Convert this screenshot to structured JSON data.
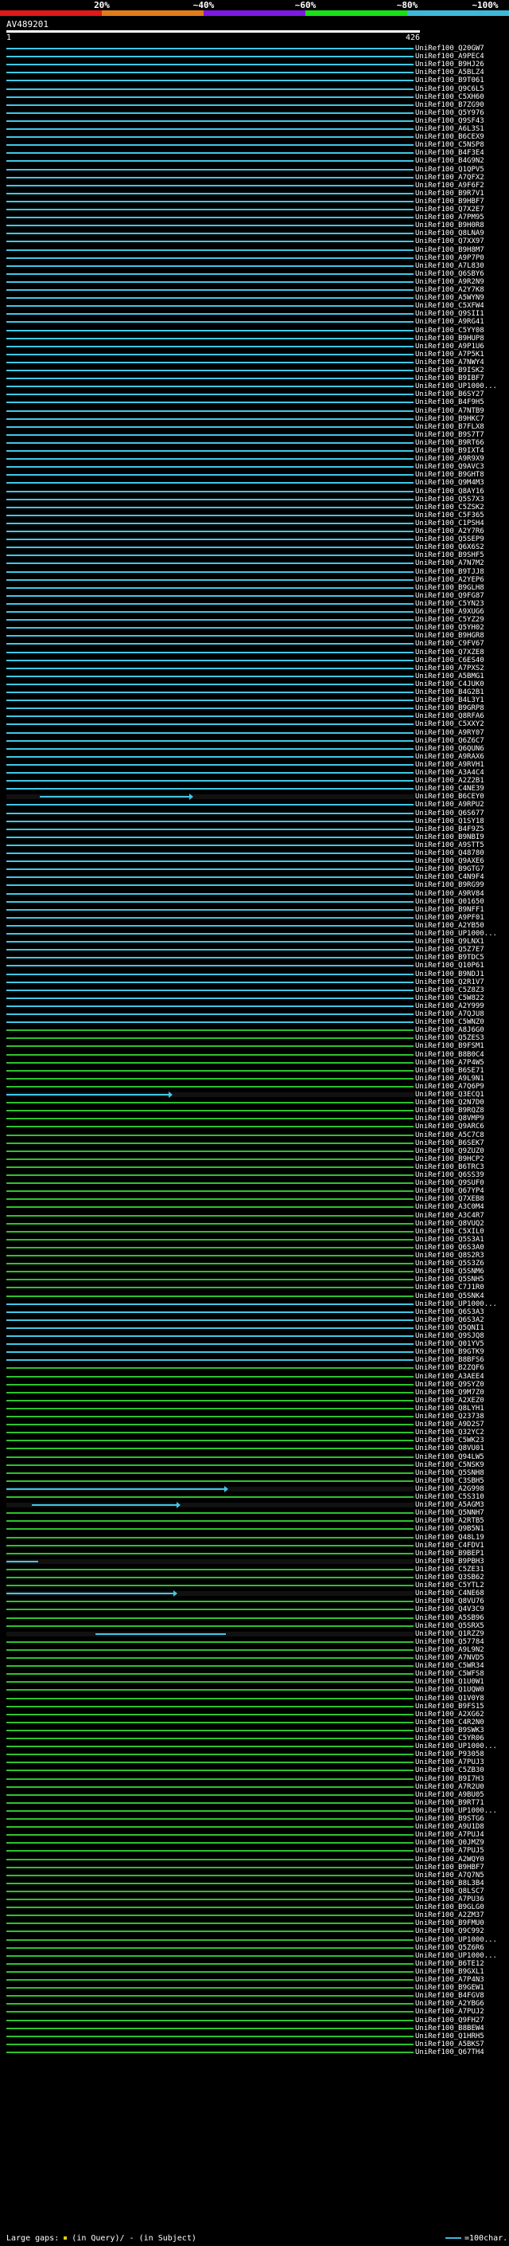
{
  "header": {
    "legend_labels": [
      "20%",
      "~40%",
      "~60%",
      "~80%",
      "~100%"
    ],
    "legend_colors": [
      "#e01919",
      "#e07d19",
      "#7d19e0",
      "#19e019",
      "#3fb8d8"
    ],
    "query_title": "AV489201",
    "ruler_start": "1",
    "ruler_end": "426"
  },
  "colors": {
    "cyan": "#3fb8d8",
    "green": "#19e019",
    "cyan_line": "#40c8e8",
    "green_line": "#2ec22e"
  },
  "hits": [
    {
      "label": "UniRef100_Q20GW7",
      "c": "cyan"
    },
    {
      "label": "UniRef100_A9PEC4",
      "c": "cyan"
    },
    {
      "label": "UniRef100_B9HJ26",
      "c": "cyan"
    },
    {
      "label": "UniRef100_A5BLZ4",
      "c": "cyan"
    },
    {
      "label": "UniRef100_B9T061",
      "c": "cyan"
    },
    {
      "label": "UniRef100_Q9C6L5",
      "c": "cyan"
    },
    {
      "label": "UniRef100_C5XH60",
      "c": "cyan"
    },
    {
      "label": "UniRef100_B7ZG90",
      "c": "cyan"
    },
    {
      "label": "UniRef100_Q5Y976",
      "c": "cyan"
    },
    {
      "label": "UniRef100_Q9SF43",
      "c": "cyan"
    },
    {
      "label": "UniRef100_A6L3S1",
      "c": "cyan"
    },
    {
      "label": "UniRef100_B6CEX9",
      "c": "cyan"
    },
    {
      "label": "UniRef100_C5NSP8",
      "c": "cyan"
    },
    {
      "label": "UniRef100_B4F3E4",
      "c": "cyan"
    },
    {
      "label": "UniRef100_B4G9N2",
      "c": "cyan"
    },
    {
      "label": "UniRef100_Q1QPV5",
      "c": "cyan"
    },
    {
      "label": "UniRef100_A7QFX2",
      "c": "cyan"
    },
    {
      "label": "UniRef100_A9F6F2",
      "c": "cyan"
    },
    {
      "label": "UniRef100_B9R7V1",
      "c": "cyan"
    },
    {
      "label": "UniRef100_B9HBF7",
      "c": "cyan"
    },
    {
      "label": "UniRef100_Q7X2E7",
      "c": "cyan"
    },
    {
      "label": "UniRef100_A7PM95",
      "c": "cyan"
    },
    {
      "label": "UniRef100_B9H0R8",
      "c": "cyan"
    },
    {
      "label": "UniRef100_Q8LNA9",
      "c": "cyan"
    },
    {
      "label": "UniRef100_Q7XX97",
      "c": "cyan"
    },
    {
      "label": "UniRef100_B9H8M7",
      "c": "cyan"
    },
    {
      "label": "UniRef100_A9P7P0",
      "c": "cyan"
    },
    {
      "label": "UniRef100_A7L830",
      "c": "cyan"
    },
    {
      "label": "UniRef100_Q6SBY6",
      "c": "cyan"
    },
    {
      "label": "UniRef100_A9R2N9",
      "c": "cyan"
    },
    {
      "label": "UniRef100_A2Y7K8",
      "c": "cyan"
    },
    {
      "label": "UniRef100_A5WYN9",
      "c": "cyan"
    },
    {
      "label": "UniRef100_C5XFW4",
      "c": "cyan"
    },
    {
      "label": "UniRef100_Q9SII1",
      "c": "cyan"
    },
    {
      "label": "UniRef100_A9RG41",
      "c": "cyan"
    },
    {
      "label": "UniRef100_C5YY08",
      "c": "cyan"
    },
    {
      "label": "UniRef100_B9HUP8",
      "c": "cyan"
    },
    {
      "label": "UniRef100_A9P1U6",
      "c": "cyan"
    },
    {
      "label": "UniRef100_A7P5K1",
      "c": "cyan"
    },
    {
      "label": "UniRef100_A7NWY4",
      "c": "cyan"
    },
    {
      "label": "UniRef100_B9ISK2",
      "c": "cyan"
    },
    {
      "label": "UniRef100_B9IBF7",
      "c": "cyan"
    },
    {
      "label": "UniRef100_UP1000...",
      "c": "cyan"
    },
    {
      "label": "UniRef100_B6SY27",
      "c": "cyan"
    },
    {
      "label": "UniRef100_B4F9H5",
      "c": "cyan"
    },
    {
      "label": "UniRef100_A7NTB9",
      "c": "cyan"
    },
    {
      "label": "UniRef100_B9HKC7",
      "c": "cyan"
    },
    {
      "label": "UniRef100_B7FLX8",
      "c": "cyan"
    },
    {
      "label": "UniRef100_B9S7T7",
      "c": "cyan"
    },
    {
      "label": "UniRef100_B9RT66",
      "c": "cyan"
    },
    {
      "label": "UniRef100_B9IXT4",
      "c": "cyan"
    },
    {
      "label": "UniRef100_A9R9X9",
      "c": "cyan"
    },
    {
      "label": "UniRef100_Q9AVC3",
      "c": "cyan"
    },
    {
      "label": "UniRef100_B9GHT8",
      "c": "cyan"
    },
    {
      "label": "UniRef100_Q9M4M3",
      "c": "cyan"
    },
    {
      "label": "UniRef100_Q8AY16",
      "c": "cyan"
    },
    {
      "label": "UniRef100_Q5S7X3",
      "c": "cyan"
    },
    {
      "label": "UniRef100_C5ZSK2",
      "c": "cyan"
    },
    {
      "label": "UniRef100_C5F365",
      "c": "cyan"
    },
    {
      "label": "UniRef100_C1PSH4",
      "c": "cyan"
    },
    {
      "label": "UniRef100_A2Y7R6",
      "c": "cyan"
    },
    {
      "label": "UniRef100_Q5SEP9",
      "c": "cyan"
    },
    {
      "label": "UniRef100_Q6X6S2",
      "c": "cyan"
    },
    {
      "label": "UniRef100_B9SHF5",
      "c": "cyan"
    },
    {
      "label": "UniRef100_A7N7M2",
      "c": "cyan"
    },
    {
      "label": "UniRef100_B9TJJ8",
      "c": "cyan"
    },
    {
      "label": "UniRef100_A2YEP6",
      "c": "cyan"
    },
    {
      "label": "UniRef100_B9GLH8",
      "c": "cyan"
    },
    {
      "label": "UniRef100_Q9FG87",
      "c": "cyan"
    },
    {
      "label": "UniRef100_C5YN23",
      "c": "cyan"
    },
    {
      "label": "UniRef100_A9XUG6",
      "c": "cyan"
    },
    {
      "label": "UniRef100_C5YZ29",
      "c": "cyan"
    },
    {
      "label": "UniRef100_Q5YH02",
      "c": "cyan"
    },
    {
      "label": "UniRef100_B9HGR8",
      "c": "cyan"
    },
    {
      "label": "UniRef100_C9FV67",
      "c": "cyan"
    },
    {
      "label": "UniRef100_Q7XZE8",
      "c": "cyan"
    },
    {
      "label": "UniRef100_C6ES40",
      "c": "cyan"
    },
    {
      "label": "UniRef100_A7PXS2",
      "c": "cyan"
    },
    {
      "label": "UniRef100_A5BMG1",
      "c": "cyan"
    },
    {
      "label": "UniRef100_C4JUK0",
      "c": "cyan"
    },
    {
      "label": "UniRef100_B4G2B1",
      "c": "cyan"
    },
    {
      "label": "UniRef100_B4L3Y1",
      "c": "cyan"
    },
    {
      "label": "UniRef100_B9GRP8",
      "c": "cyan"
    },
    {
      "label": "UniRef100_Q8RFA6",
      "c": "cyan"
    },
    {
      "label": "UniRef100_C5XXY2",
      "c": "cyan"
    },
    {
      "label": "UniRef100_A9RY07",
      "c": "cyan"
    },
    {
      "label": "UniRef100_Q6Z6C7",
      "c": "cyan"
    },
    {
      "label": "UniRef100_Q6QUN6",
      "c": "cyan"
    },
    {
      "label": "UniRef100_A9RAX6",
      "c": "cyan"
    },
    {
      "label": "UniRef100_A9RVH1",
      "c": "cyan"
    },
    {
      "label": "UniRef100_A3A4C4",
      "c": "cyan"
    },
    {
      "label": "UniRef100_A2Z2B1",
      "c": "cyan"
    },
    {
      "label": "UniRef100_C4NE39",
      "c": "cyan"
    },
    {
      "label": "UniRef100_B6CEY0",
      "c": "cyan",
      "partial": [
        50,
        238
      ],
      "arrow": true
    },
    {
      "label": "UniRef100_A9RPU2",
      "c": "cyan"
    },
    {
      "label": "UniRef100_Q6S677",
      "c": "cyan"
    },
    {
      "label": "UniRef100_Q1SY18",
      "c": "cyan"
    },
    {
      "label": "UniRef100_B4F9Z5",
      "c": "cyan"
    },
    {
      "label": "UniRef100_B9NBI9",
      "c": "cyan"
    },
    {
      "label": "UniRef100_A9STT5",
      "c": "cyan"
    },
    {
      "label": "UniRef100_Q48780",
      "c": "cyan"
    },
    {
      "label": "UniRef100_Q9AXE6",
      "c": "cyan"
    },
    {
      "label": "UniRef100_B9GTG7",
      "c": "cyan"
    },
    {
      "label": "UniRef100_C4N9F4",
      "c": "cyan"
    },
    {
      "label": "UniRef100_B9RG99",
      "c": "cyan"
    },
    {
      "label": "UniRef100_A9RV84",
      "c": "cyan"
    },
    {
      "label": "UniRef100_Q01650",
      "c": "cyan"
    },
    {
      "label": "UniRef100_B9NFF1",
      "c": "cyan"
    },
    {
      "label": "UniRef100_A9PF01",
      "c": "cyan"
    },
    {
      "label": "UniRef100_A2YB50",
      "c": "cyan"
    },
    {
      "label": "UniRef100_UP1000...",
      "c": "cyan"
    },
    {
      "label": "UniRef100_Q9LNX1",
      "c": "cyan"
    },
    {
      "label": "UniRef100_Q5Z7E7",
      "c": "cyan"
    },
    {
      "label": "UniRef100_B9TDC5",
      "c": "cyan"
    },
    {
      "label": "UniRef100_Q10P61",
      "c": "cyan"
    },
    {
      "label": "UniRef100_B9NDJ1",
      "c": "cyan"
    },
    {
      "label": "UniRef100_Q2R1V7",
      "c": "cyan"
    },
    {
      "label": "UniRef100_C5Z8Z3",
      "c": "cyan"
    },
    {
      "label": "UniRef100_C5W822",
      "c": "cyan"
    },
    {
      "label": "UniRef100_A2Y999",
      "c": "cyan"
    },
    {
      "label": "UniRef100_A7QJU8",
      "c": "cyan"
    },
    {
      "label": "UniRef100_C5WNZ0",
      "c": "cyan"
    },
    {
      "label": "UniRef100_A8J6G0",
      "c": "green"
    },
    {
      "label": "UniRef100_Q5ZES3",
      "c": "green"
    },
    {
      "label": "UniRef100_B9FSM1",
      "c": "green"
    },
    {
      "label": "UniRef100_B8B0C4",
      "c": "green"
    },
    {
      "label": "UniRef100_A7P4W5",
      "c": "green"
    },
    {
      "label": "UniRef100_B6SE71",
      "c": "green"
    },
    {
      "label": "UniRef100_A9L9N1",
      "c": "green"
    },
    {
      "label": "UniRef100_A7Q6P9",
      "c": "green"
    },
    {
      "label": "UniRef100_Q3ECQ1",
      "c": "cyan",
      "partial": [
        8,
        212
      ],
      "arrow": true
    },
    {
      "label": "UniRef100_Q2N7D0",
      "c": "green"
    },
    {
      "label": "UniRef100_B9RQZ8",
      "c": "green"
    },
    {
      "label": "UniRef100_Q8VMP9",
      "c": "green"
    },
    {
      "label": "UniRef100_Q9ARC6",
      "c": "green"
    },
    {
      "label": "UniRef100_A5C7C8",
      "c": "green"
    },
    {
      "label": "UniRef100_B6SEK7",
      "c": "green"
    },
    {
      "label": "UniRef100_Q9ZUZ0",
      "c": "green"
    },
    {
      "label": "UniRef100_B9HCP2",
      "c": "green"
    },
    {
      "label": "UniRef100_B6TRC3",
      "c": "green"
    },
    {
      "label": "UniRef100_Q6SS39",
      "c": "green"
    },
    {
      "label": "UniRef100_Q9SUF0",
      "c": "green"
    },
    {
      "label": "UniRef100_Q67YP4",
      "c": "green"
    },
    {
      "label": "UniRef100_Q7XEB8",
      "c": "green"
    },
    {
      "label": "UniRef100_A3C0M4",
      "c": "green"
    },
    {
      "label": "UniRef100_A3C4R7",
      "c": "green"
    },
    {
      "label": "UniRef100_Q8VUQ2",
      "c": "green"
    },
    {
      "label": "UniRef100_C5XIL0",
      "c": "green"
    },
    {
      "label": "UniRef100_Q5S3A1",
      "c": "green"
    },
    {
      "label": "UniRef100_Q6S3A0",
      "c": "green"
    },
    {
      "label": "UniRef100_Q8S2R3",
      "c": "green"
    },
    {
      "label": "UniRef100_Q5S3Z6",
      "c": "green"
    },
    {
      "label": "UniRef100_Q5SNM6",
      "c": "green"
    },
    {
      "label": "UniRef100_Q5SNH5",
      "c": "green"
    },
    {
      "label": "UniRef100_C7J1R0",
      "c": "green"
    },
    {
      "label": "UniRef100_Q5SNK4",
      "c": "green"
    },
    {
      "label": "UniRef100_UP1000...",
      "c": "cyan"
    },
    {
      "label": "UniRef100_Q6S3A3",
      "c": "cyan"
    },
    {
      "label": "UniRef100_Q6S3A2",
      "c": "cyan"
    },
    {
      "label": "UniRef100_Q5QNI1",
      "c": "cyan"
    },
    {
      "label": "UniRef100_Q9SJQ8",
      "c": "cyan"
    },
    {
      "label": "UniRef100_Q01YV5",
      "c": "cyan"
    },
    {
      "label": "UniRef100_B9GTK9",
      "c": "cyan"
    },
    {
      "label": "UniRef100_B8BFS6",
      "c": "cyan"
    },
    {
      "label": "UniRef100_B2ZQF6",
      "c": "green"
    },
    {
      "label": "UniRef100_A3AEE4",
      "c": "green"
    },
    {
      "label": "UniRef100_Q9SYZ0",
      "c": "green"
    },
    {
      "label": "UniRef100_Q9M7Z0",
      "c": "green"
    },
    {
      "label": "UniRef100_A2XEZ0",
      "c": "green"
    },
    {
      "label": "UniRef100_Q8LYH1",
      "c": "green"
    },
    {
      "label": "UniRef100_Q23738",
      "c": "green"
    },
    {
      "label": "UniRef100_A9D2S7",
      "c": "green"
    },
    {
      "label": "UniRef100_Q32YC2",
      "c": "green"
    },
    {
      "label": "UniRef100_C5WK23",
      "c": "green"
    },
    {
      "label": "UniRef100_Q8VU01",
      "c": "green"
    },
    {
      "label": "UniRef100_Q94LW5",
      "c": "green"
    },
    {
      "label": "UniRef100_C5NSK9",
      "c": "green"
    },
    {
      "label": "UniRef100_Q5SNH8",
      "c": "green"
    },
    {
      "label": "UniRef100_C3SBH5",
      "c": "green"
    },
    {
      "label": "UniRef100_A2G998",
      "c": "cyan",
      "partial": [
        8,
        282
      ],
      "arrow": true
    },
    {
      "label": "UniRef100_C5S310",
      "c": "green"
    },
    {
      "label": "UniRef100_A5AGM3",
      "c": "cyan",
      "partial": [
        40,
        222
      ],
      "arrow": true
    },
    {
      "label": "UniRef100_Q5NNH7",
      "c": "green"
    },
    {
      "label": "UniRef100_A2RTB5",
      "c": "green"
    },
    {
      "label": "UniRef100_Q9B5N1",
      "c": "green"
    },
    {
      "label": "UniRef100_Q48L19",
      "c": "green"
    },
    {
      "label": "UniRef100_C4FDV1",
      "c": "green"
    },
    {
      "label": "UniRef100_B9BEP1",
      "c": "green"
    },
    {
      "label": "UniRef100_B9PBH3",
      "c": "cyan",
      "partial": [
        8,
        48
      ],
      "arrow": false
    },
    {
      "label": "UniRef100_C5ZE31",
      "c": "green"
    },
    {
      "label": "UniRef100_Q3SB62",
      "c": "green"
    },
    {
      "label": "UniRef100_C5YTL2",
      "c": "green"
    },
    {
      "label": "UniRef100_C4NE68",
      "c": "cyan",
      "partial": [
        8,
        218
      ],
      "arrow": true
    },
    {
      "label": "UniRef100_Q8VU76",
      "c": "green"
    },
    {
      "label": "UniRef100_Q4V3C9",
      "c": "green"
    },
    {
      "label": "UniRef100_A5SB96",
      "c": "green"
    },
    {
      "label": "UniRef100_Q5SRX5",
      "c": "green"
    },
    {
      "label": "UniRef100_Q1RZZ9",
      "c": "cyan",
      "partial": [
        120,
        284
      ],
      "arrow": false
    },
    {
      "label": "UniRef100_Q57784",
      "c": "green"
    },
    {
      "label": "UniRef100_A9L9N2",
      "c": "green"
    },
    {
      "label": "UniRef100_A7NVD5",
      "c": "green"
    },
    {
      "label": "UniRef100_C5WR34",
      "c": "green"
    },
    {
      "label": "UniRef100_C5WFS8",
      "c": "green"
    },
    {
      "label": "UniRef100_Q1U0W1",
      "c": "green"
    },
    {
      "label": "UniRef100_Q1UQW0",
      "c": "green"
    },
    {
      "label": "UniRef100_Q1V0Y8",
      "c": "green"
    },
    {
      "label": "UniRef100_B9FS15",
      "c": "green"
    },
    {
      "label": "UniRef100_A2XG62",
      "c": "green"
    },
    {
      "label": "UniRef100_C4R2N0",
      "c": "green"
    },
    {
      "label": "UniRef100_B9SWK3",
      "c": "green"
    },
    {
      "label": "UniRef100_C5YR06",
      "c": "green"
    },
    {
      "label": "UniRef100_UP1000...",
      "c": "green"
    },
    {
      "label": "UniRef100_P93058",
      "c": "green"
    },
    {
      "label": "UniRef100_A7PUJ3",
      "c": "green"
    },
    {
      "label": "UniRef100_C5ZB30",
      "c": "green"
    },
    {
      "label": "UniRef100_B9I7H3",
      "c": "green"
    },
    {
      "label": "UniRef100_A7R2U0",
      "c": "green"
    },
    {
      "label": "UniRef100_A9BU05",
      "c": "green"
    },
    {
      "label": "UniRef100_B9RT71",
      "c": "green"
    },
    {
      "label": "UniRef100_UP1000...",
      "c": "green"
    },
    {
      "label": "UniRef100_B9STG6",
      "c": "green"
    },
    {
      "label": "UniRef100_A9U1D8",
      "c": "green"
    },
    {
      "label": "UniRef100_A7PUJ4",
      "c": "green"
    },
    {
      "label": "UniRef100_Q0JMZ9",
      "c": "green"
    },
    {
      "label": "UniRef100_A7PUJ5",
      "c": "green"
    },
    {
      "label": "UniRef100_A2WQY0",
      "c": "green"
    },
    {
      "label": "UniRef100_B9HBF7",
      "c": "green"
    },
    {
      "label": "UniRef100_A7Q7N5",
      "c": "green"
    },
    {
      "label": "UniRef100_B8L3B4",
      "c": "green"
    },
    {
      "label": "UniRef100_Q8LSC7",
      "c": "green"
    },
    {
      "label": "UniRef100_A7PU36",
      "c": "green"
    },
    {
      "label": "UniRef100_B9GLG0",
      "c": "green"
    },
    {
      "label": "UniRef100_A2ZM37",
      "c": "green"
    },
    {
      "label": "UniRef100_B9FMU0",
      "c": "green"
    },
    {
      "label": "UniRef100_Q9C992",
      "c": "green"
    },
    {
      "label": "UniRef100_UP1000...",
      "c": "green"
    },
    {
      "label": "UniRef100_Q5Z6R6",
      "c": "green"
    },
    {
      "label": "UniRef100_UP1000...",
      "c": "green"
    },
    {
      "label": "UniRef100_B6TE12",
      "c": "green"
    },
    {
      "label": "UniRef100_B9GXL1",
      "c": "green"
    },
    {
      "label": "UniRef100_A7P4N3",
      "c": "green"
    },
    {
      "label": "UniRef100_B9GEW1",
      "c": "green"
    },
    {
      "label": "UniRef100_B4FGV8",
      "c": "green"
    },
    {
      "label": "UniRef100_A2YBG6",
      "c": "green"
    },
    {
      "label": "UniRef100_A7PUJ2",
      "c": "green"
    },
    {
      "label": "UniRef100_Q9FH27",
      "c": "green"
    },
    {
      "label": "UniRef100_B8BEW4",
      "c": "green"
    },
    {
      "label": "UniRef100_Q1HRH5",
      "c": "green"
    },
    {
      "label": "UniRef100_A5BKS7",
      "c": "green"
    },
    {
      "label": "UniRef100_Q67TH4",
      "c": "green"
    }
  ],
  "footer": {
    "large_gaps": "Large gaps:",
    "in_query": "(in Query)/",
    "in_subject": "(in Subject)",
    "scale": "=100char."
  }
}
